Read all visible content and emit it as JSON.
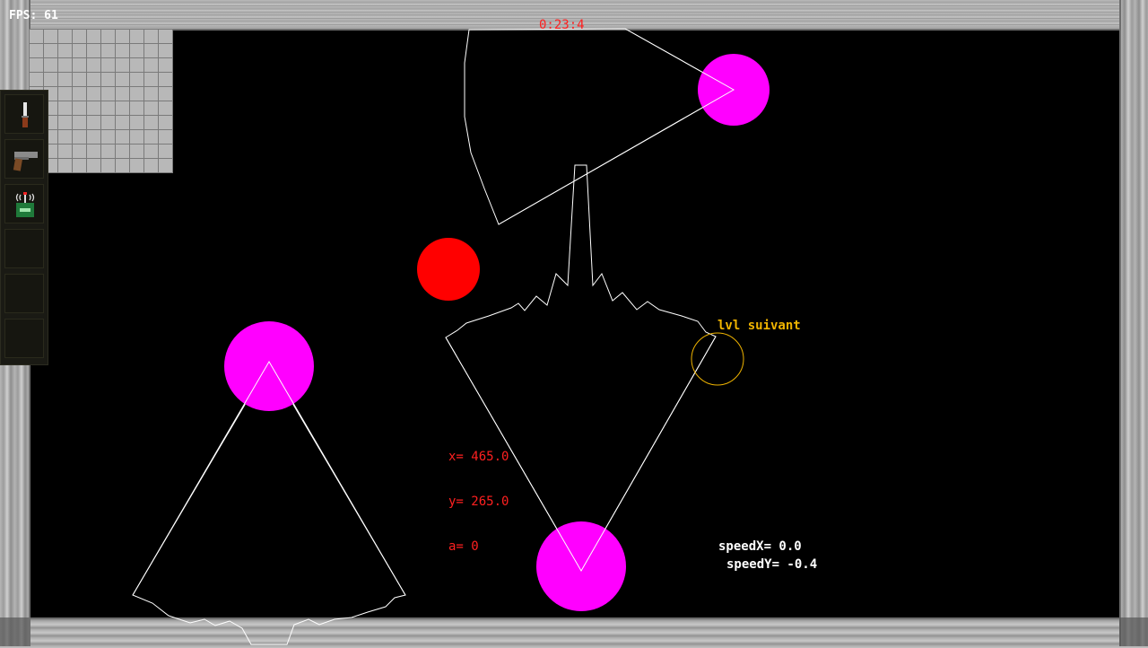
{
  "hud": {
    "fps": "FPS: 61",
    "timer": "0:23:4",
    "x": "x= 465.0",
    "y": "y= 265.0",
    "a": "a= 0",
    "speed_x": "speedX= 0.0",
    "speed_y": "speedY= -0.4"
  },
  "goal": {
    "label": "lvl suivant"
  },
  "inventory": {
    "slots": [
      {
        "item": "knife-icon"
      },
      {
        "item": "pistol-icon"
      },
      {
        "item": "radio-detonator-icon"
      },
      {
        "item": ""
      },
      {
        "item": ""
      },
      {
        "item": ""
      }
    ]
  },
  "colors": {
    "player": "#ff0000",
    "enemy": "#ff00ff",
    "goal": "#f0b400",
    "hud_text": "#ff2020",
    "vision": "#ffffff"
  }
}
